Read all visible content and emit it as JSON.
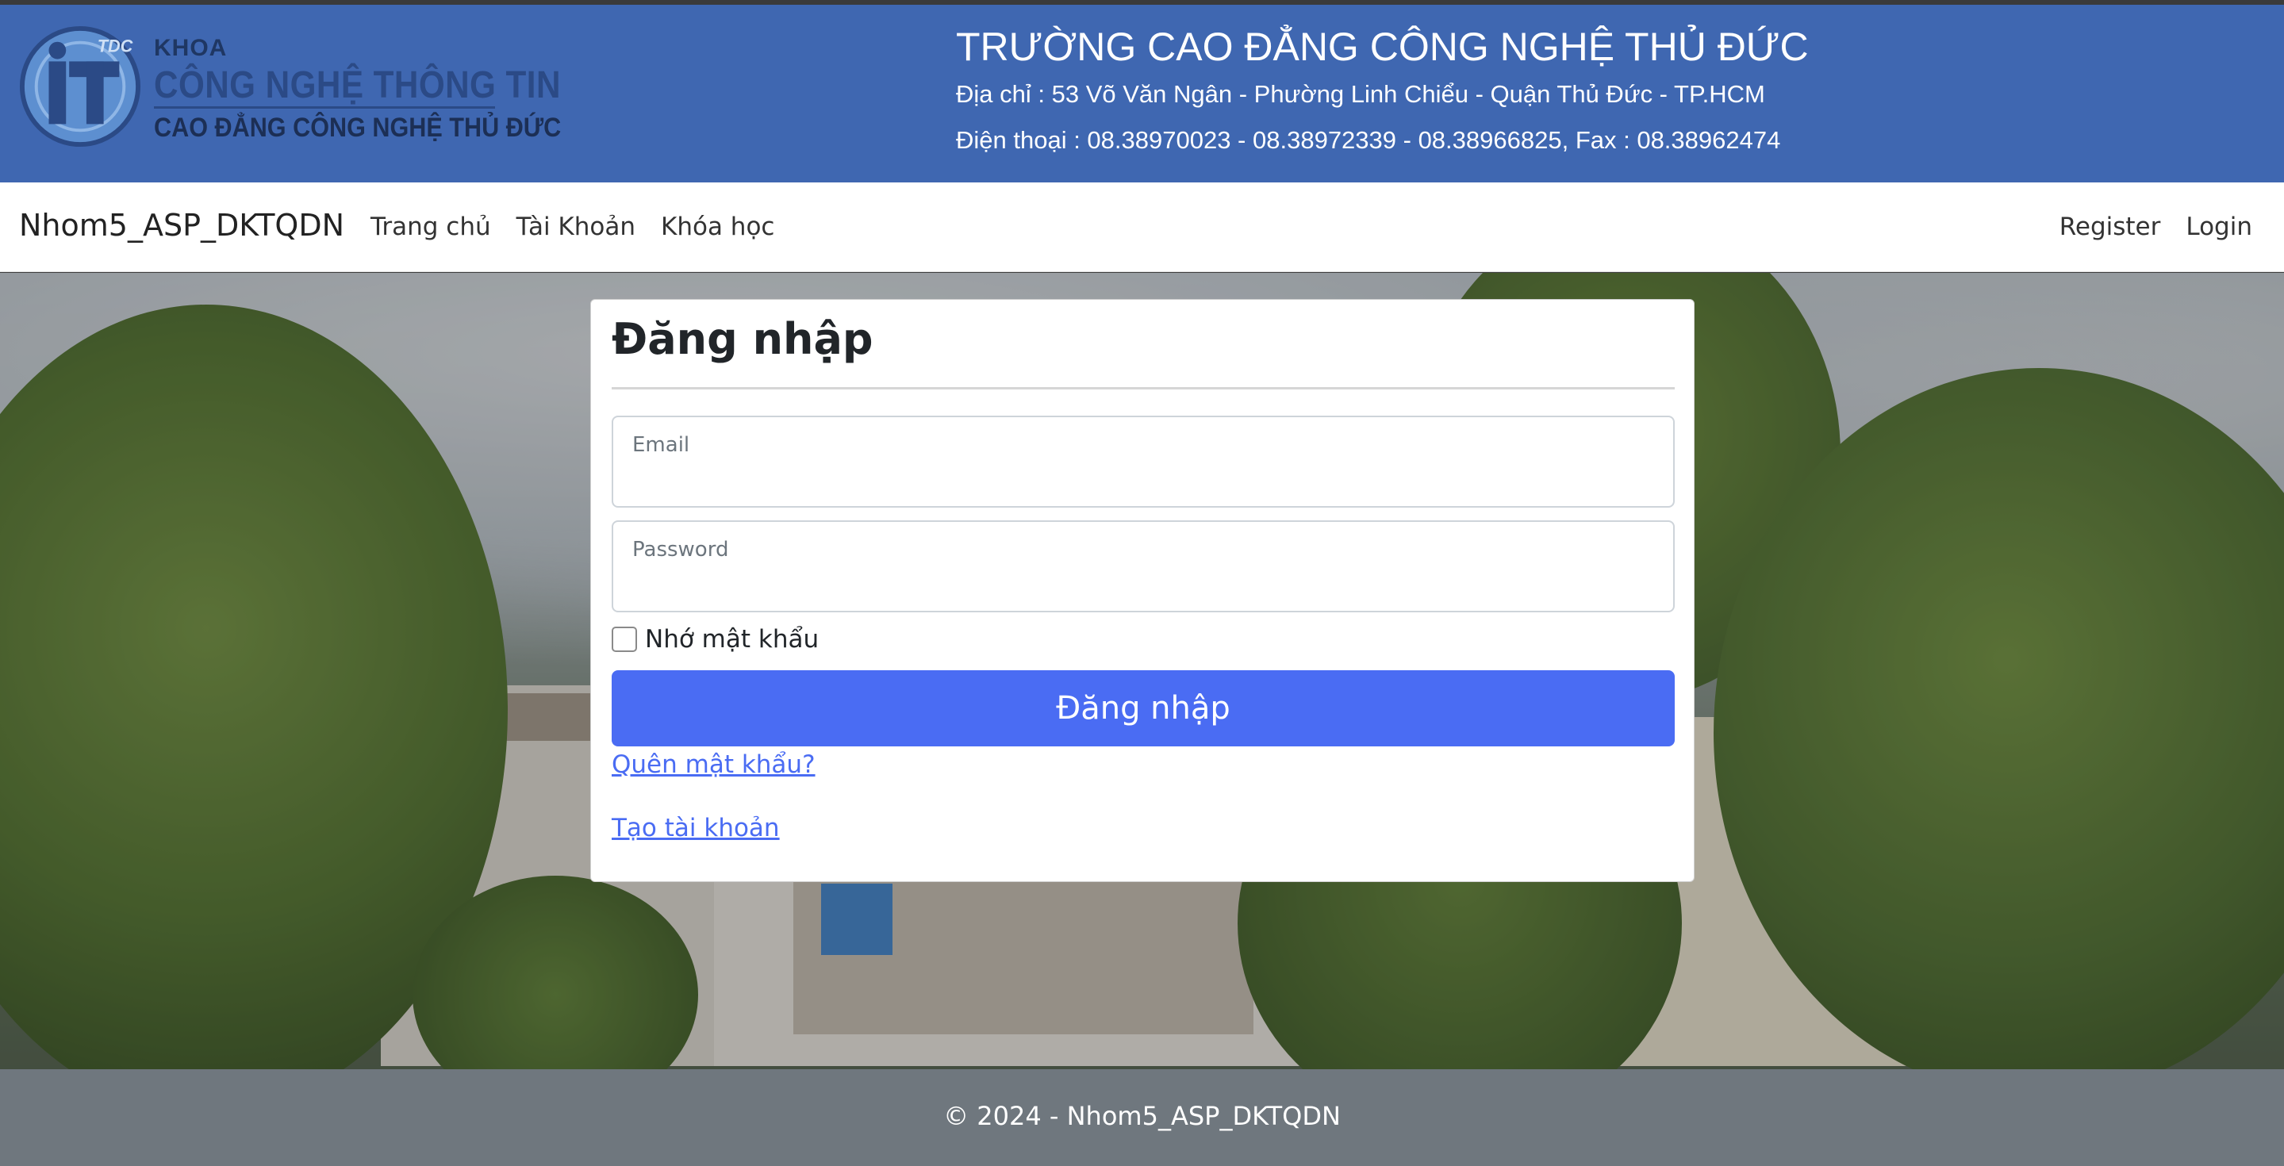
{
  "header": {
    "logo": {
      "badge_text": "TDC",
      "line1": "KHOA",
      "line2": "CÔNG NGHỆ THÔNG TIN",
      "line3": "CAO ĐẲNG CÔNG NGHỆ THỦ ĐỨC"
    },
    "school_name": "TRƯỜNG CAO ĐẲNG CÔNG NGHỆ THỦ ĐỨC",
    "address": "Địa chỉ : 53 Võ Văn Ngân - Phường Linh Chiểu - Quận Thủ Đức - TP.HCM",
    "phone": "Điện thoại : 08.38970023 - 08.38972339 - 08.38966825, Fax : 08.38962474",
    "banner_color": "#3f67b1"
  },
  "navbar": {
    "brand": "Nhom5_ASP_DKTQDN",
    "left_links": [
      "Trang chủ",
      "Tài Khoản",
      "Khóa học"
    ],
    "right_links": [
      "Register",
      "Login"
    ]
  },
  "login": {
    "title": "Đăng nhập",
    "email_label": "Email",
    "email_value": "",
    "password_label": "Password",
    "password_value": "",
    "remember_label": "Nhớ mật khẩu",
    "remember_checked": false,
    "submit_label": "Đăng nhập",
    "forgot_link": "Quên mật khẩu?",
    "create_link": "Tạo tài khoản",
    "accent_color": "#4a6cf3"
  },
  "footer": {
    "text": "© 2024 - Nhom5_ASP_DKTQDN"
  }
}
